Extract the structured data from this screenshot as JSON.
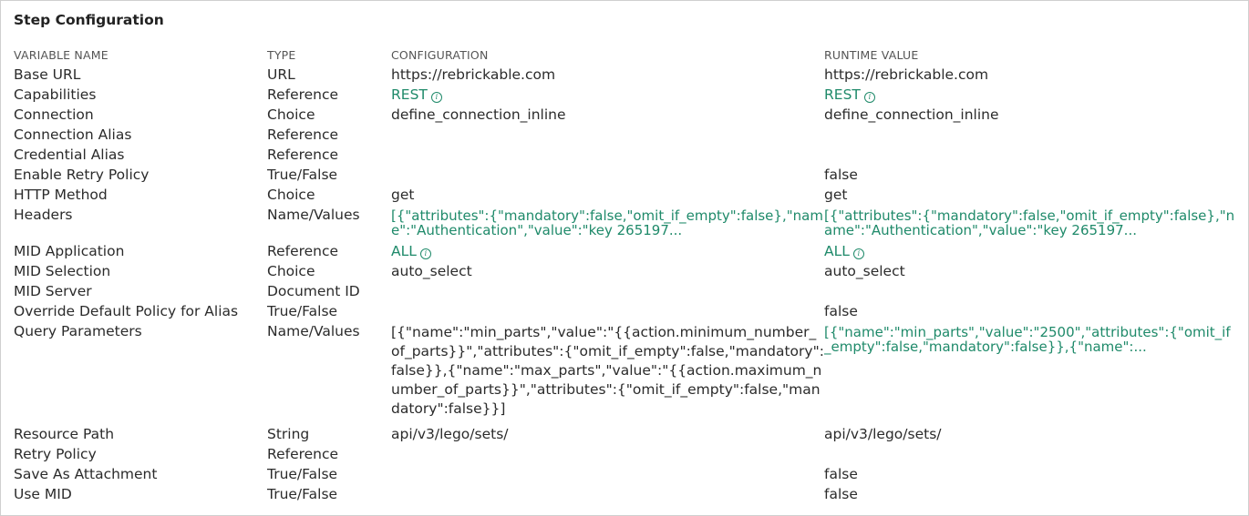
{
  "title": "Step Configuration",
  "headers": {
    "variable_name": "VARIABLE NAME",
    "type": "TYPE",
    "configuration": "CONFIGURATION",
    "runtime_value": "RUNTIME VALUE"
  },
  "rows": {
    "base_url": {
      "name": "Base URL",
      "type": "URL",
      "config": "https://rebrickable.com",
      "runtime": "https://rebrickable.com"
    },
    "capabilities": {
      "name": "Capabilities",
      "type": "Reference",
      "config": "REST",
      "runtime": "REST"
    },
    "connection": {
      "name": "Connection",
      "type": "Choice",
      "config": "define_connection_inline",
      "runtime": "define_connection_inline"
    },
    "connection_alias": {
      "name": "Connection Alias",
      "type": "Reference",
      "config": "",
      "runtime": ""
    },
    "credential_alias": {
      "name": "Credential Alias",
      "type": "Reference",
      "config": "",
      "runtime": ""
    },
    "enable_retry_policy": {
      "name": "Enable Retry Policy",
      "type": "True/False",
      "config": "",
      "runtime": "false"
    },
    "http_method": {
      "name": "HTTP Method",
      "type": "Choice",
      "config": "get",
      "runtime": "get"
    },
    "headers": {
      "name": "Headers",
      "type": "Name/Values",
      "config": "[{\"attributes\":{\"mandatory\":false,\"omit_if_empty\":false},\"name\":\"Authentication\",\"value\":\"key 265197...",
      "runtime": "[{\"attributes\":{\"mandatory\":false,\"omit_if_empty\":false},\"name\":\"Authentication\",\"value\":\"key 265197..."
    },
    "mid_application": {
      "name": "MID Application",
      "type": "Reference",
      "config": "ALL",
      "runtime": "ALL"
    },
    "mid_selection": {
      "name": "MID Selection",
      "type": "Choice",
      "config": "auto_select",
      "runtime": "auto_select"
    },
    "mid_server": {
      "name": "MID Server",
      "type": "Document ID",
      "config": "",
      "runtime": ""
    },
    "override_default_policy": {
      "name": "Override Default Policy for Alias",
      "type": "True/False",
      "config": "",
      "runtime": "false"
    },
    "query_parameters": {
      "name": "Query Parameters",
      "type": "Name/Values",
      "config": "[{\"name\":\"min_parts\",\"value\":\"{{action.minimum_number_of_parts}}\",\"attributes\":{\"omit_if_empty\":false,\"mandatory\":false}},{\"name\":\"max_parts\",\"value\":\"{{action.maximum_number_of_parts}}\",\"attributes\":{\"omit_if_empty\":false,\"mandatory\":false}}]",
      "runtime": "[{\"name\":\"min_parts\",\"value\":\"2500\",\"attributes\":{\"omit_if_empty\":false,\"mandatory\":false}},{\"name\":..."
    },
    "resource_path": {
      "name": "Resource Path",
      "type": "String",
      "config": "api/v3/lego/sets/",
      "runtime": "api/v3/lego/sets/"
    },
    "retry_policy": {
      "name": "Retry Policy",
      "type": "Reference",
      "config": "",
      "runtime": ""
    },
    "save_as_attachment": {
      "name": "Save As Attachment",
      "type": "True/False",
      "config": "",
      "runtime": "false"
    },
    "use_mid": {
      "name": "Use MID",
      "type": "True/False",
      "config": "",
      "runtime": "false"
    }
  },
  "colors": {
    "link": "#1f8a6a",
    "text": "#2b2b2b",
    "header": "#555555",
    "border": "#cfcfcf"
  },
  "icons": {
    "info": "info-circle-icon"
  }
}
